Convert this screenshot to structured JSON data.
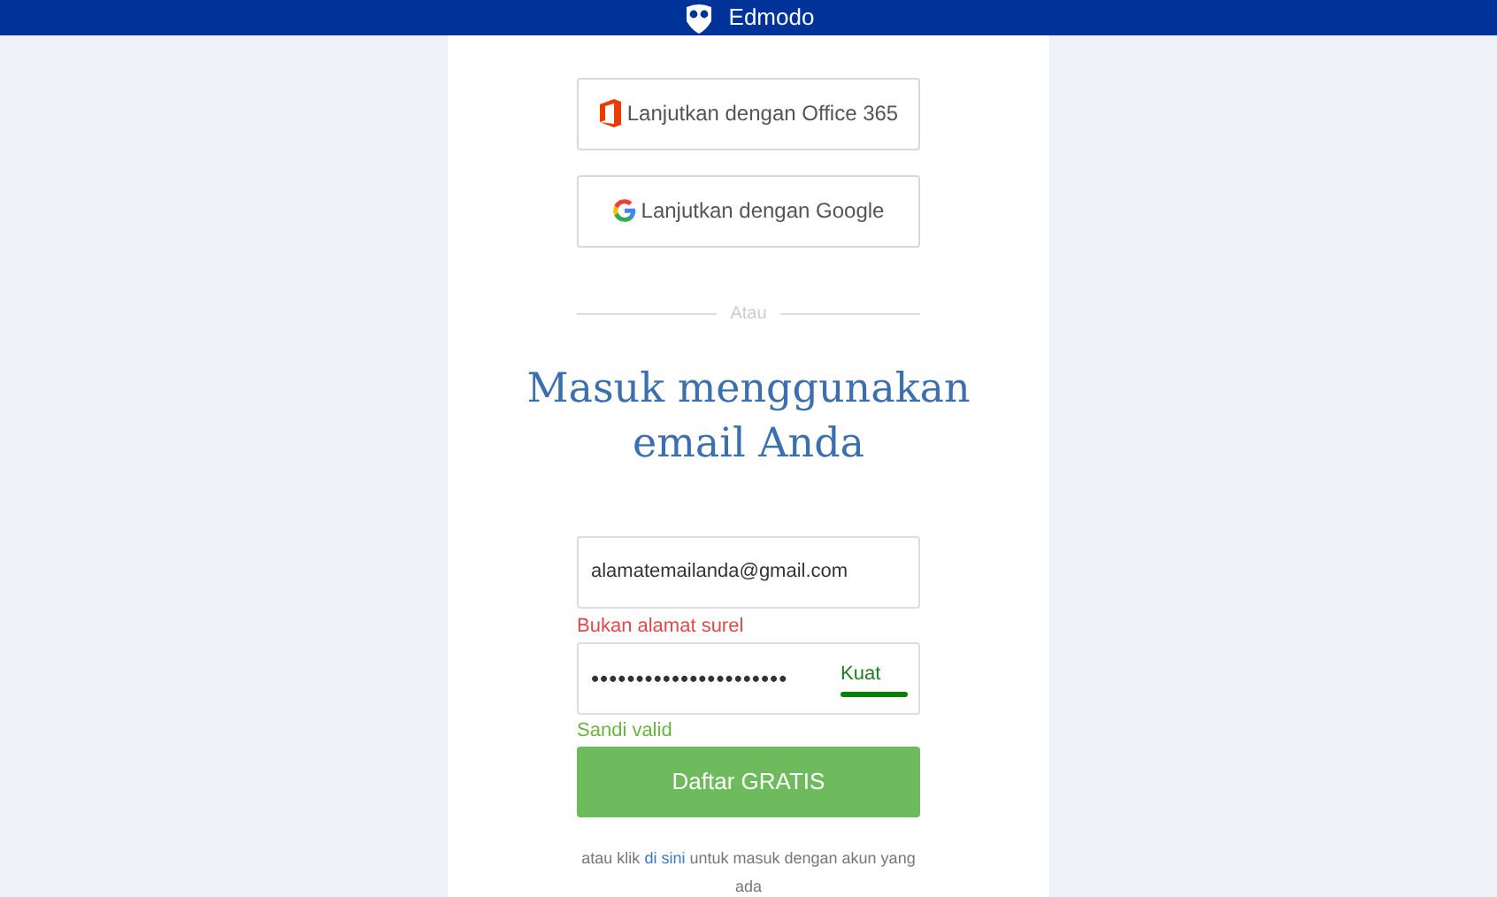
{
  "header": {
    "brand": "Edmodo"
  },
  "sso_buttons": [
    {
      "kind": "office",
      "label": "Lanjutkan dengan Office 365"
    },
    {
      "kind": "google",
      "label": "Lanjutkan dengan Google"
    }
  ],
  "divider": "Atau",
  "heading": "Masuk menggunakan email Anda",
  "email": {
    "value": "alamatemailanda@gmail.com",
    "error": "Bukan alamat surel"
  },
  "password": {
    "value": "••••••••••••••••••••••",
    "strength": "Kuat",
    "level": 1,
    "hint": "Sandi valid"
  },
  "submit": "Daftar GRATIS",
  "footer": {
    "before": "atau klik",
    "link": "di sini",
    "after": "untuk masuk dengan akun yang ada"
  }
}
